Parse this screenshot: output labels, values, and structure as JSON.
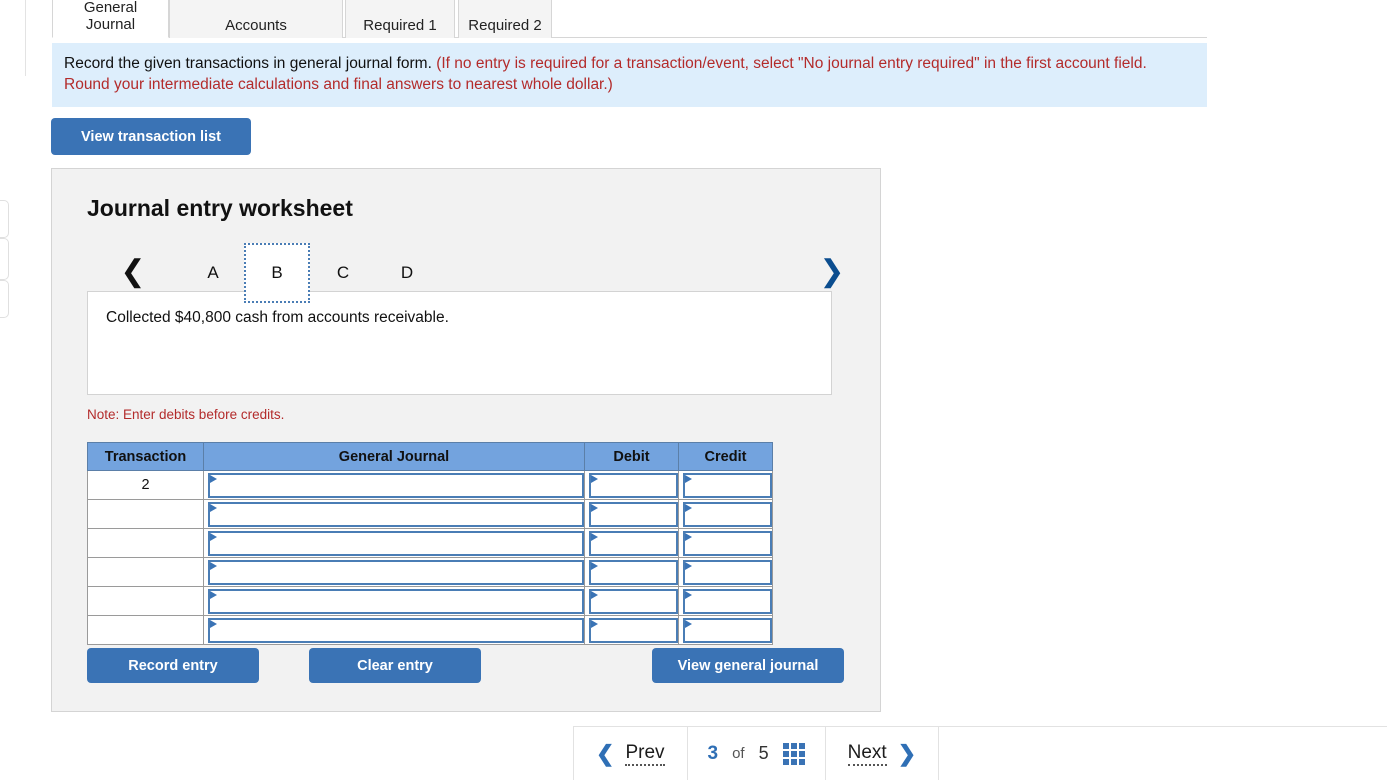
{
  "tabs": [
    {
      "label": "General\nJournal",
      "active": true
    },
    {
      "label": "Accounts",
      "active": false
    },
    {
      "label": "Required 1",
      "active": false
    },
    {
      "label": "Required 2",
      "active": false
    }
  ],
  "banner": {
    "main": "Record the given transactions in general journal form. ",
    "hint": "(If no entry is required for a transaction/event, select \"No journal entry required\" in the first account field. Round your intermediate calculations and final answers to nearest whole dollar.)"
  },
  "toolbar": {
    "view_transaction_list": "View transaction list"
  },
  "worksheet": {
    "title": "Journal entry worksheet",
    "pager": {
      "prev_icon": "chevron-left",
      "next_icon": "chevron-right",
      "items": [
        "A",
        "B",
        "C",
        "D"
      ],
      "selected": "B"
    },
    "description": "Collected $40,800 cash from accounts receivable.",
    "note": "Note: Enter debits before credits.",
    "table": {
      "headers": [
        "Transaction",
        "General Journal",
        "Debit",
        "Credit"
      ],
      "rows": [
        {
          "transaction": "2",
          "general_journal": "",
          "debit": "",
          "credit": ""
        },
        {
          "transaction": "",
          "general_journal": "",
          "debit": "",
          "credit": ""
        },
        {
          "transaction": "",
          "general_journal": "",
          "debit": "",
          "credit": ""
        },
        {
          "transaction": "",
          "general_journal": "",
          "debit": "",
          "credit": ""
        },
        {
          "transaction": "",
          "general_journal": "",
          "debit": "",
          "credit": ""
        },
        {
          "transaction": "",
          "general_journal": "",
          "debit": "",
          "credit": ""
        }
      ]
    },
    "actions": {
      "record_entry": "Record entry",
      "clear_entry": "Clear entry",
      "view_general_journal": "View general journal"
    }
  },
  "bottom_nav": {
    "prev_label": "Prev",
    "next_label": "Next",
    "current_page": "3",
    "of_word": "of",
    "total_pages": "5",
    "grid_icon": "grid-3x3-icon",
    "prev_icon": "chevron-left-icon",
    "next_icon": "chevron-right-icon"
  },
  "colors": {
    "accent_blue": "#3a73b5",
    "table_header_blue": "#73a3de",
    "banner_blue": "#ddeefc",
    "warning_red": "#b32b2b",
    "card_gray": "#f2f2f2"
  }
}
